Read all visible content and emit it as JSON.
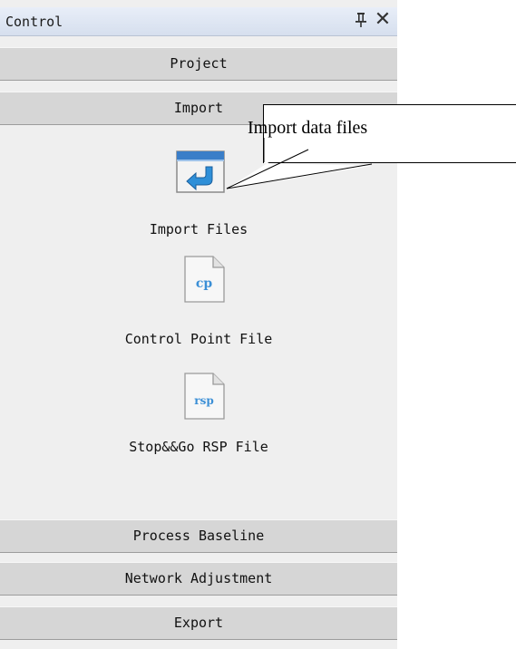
{
  "panel": {
    "title": "Control",
    "pin_icon": "pin-icon",
    "close_symbol": "✕",
    "sections": {
      "project": "Project",
      "import": "Import",
      "process_baseline": "Process Baseline",
      "network_adjustment": "Network Adjustment",
      "export": "Export"
    },
    "tools": {
      "import_files": {
        "label": "Import Files",
        "icon": "import-files-icon"
      },
      "control_point_file": {
        "label": "Control Point File",
        "icon": "cp-file-icon",
        "badge": "cp"
      },
      "stopgo_rsp_file": {
        "label": "Stop&&Go RSP File",
        "icon": "rsp-file-icon",
        "badge": "rsp"
      }
    }
  },
  "callout": {
    "text": "Import data files"
  },
  "colors": {
    "titlebar": "#dbe3f0",
    "section_button": "#d6d6d6",
    "panel_bg": "#efefef",
    "icon_blue": "#2e8fd8"
  }
}
